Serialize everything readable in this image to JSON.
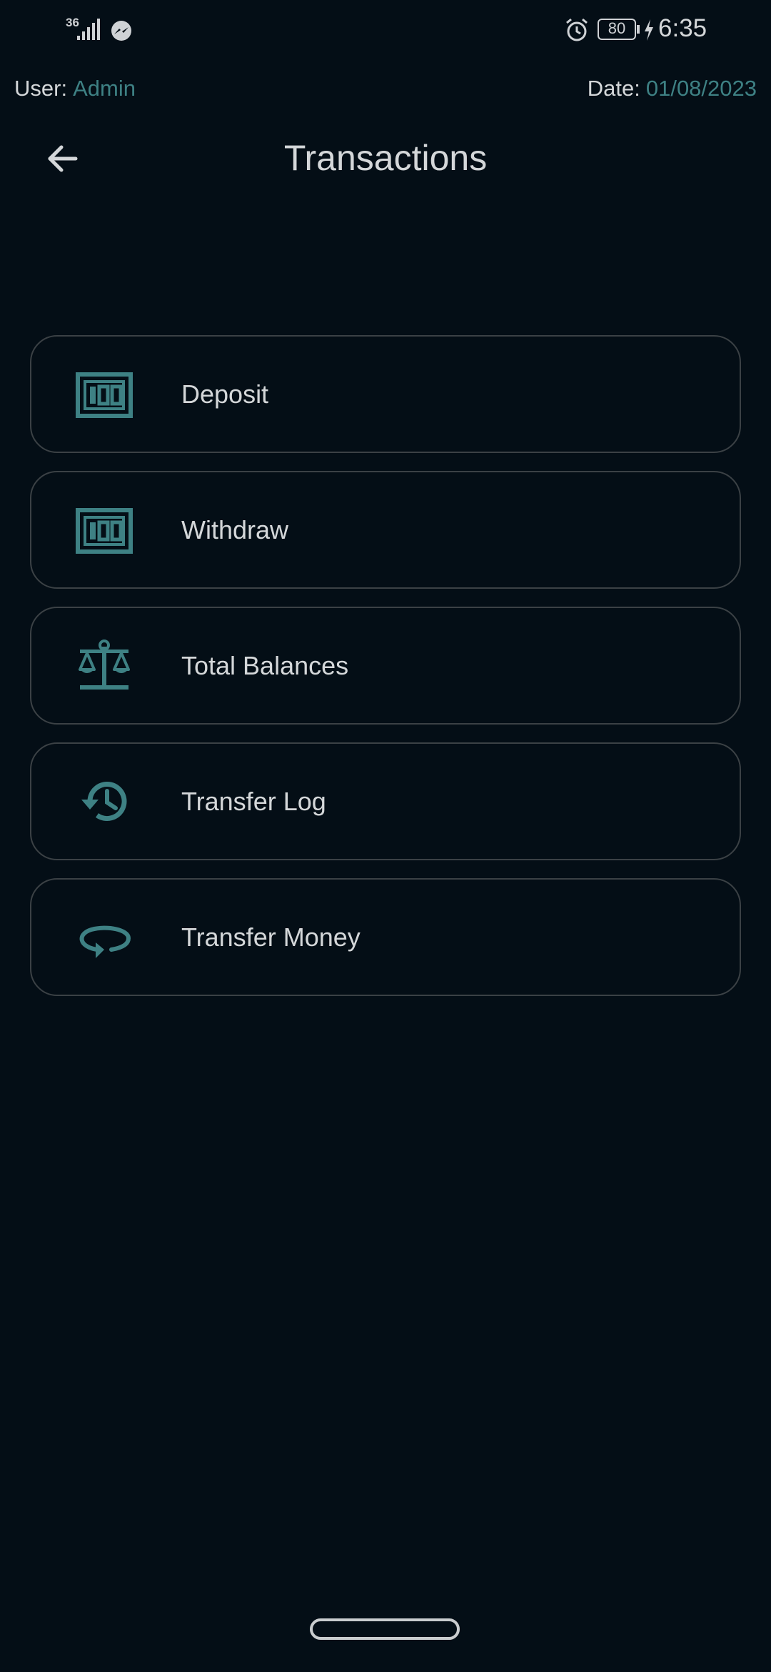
{
  "status_bar": {
    "network_type": "36",
    "battery": "80",
    "time": "6:35",
    "icons": [
      "signal-icon",
      "messenger-icon",
      "alarm-icon",
      "battery-icon",
      "charging-icon"
    ]
  },
  "header": {
    "user_label": "User:",
    "user_value": "Admin",
    "date_label": "Date:",
    "date_value": "01/08/2023",
    "title": "Transactions",
    "back_icon": "arrow-left-icon"
  },
  "menu": {
    "items": [
      {
        "label": "Deposit",
        "icon": "money-bill-icon"
      },
      {
        "label": "Withdraw",
        "icon": "money-bill-icon"
      },
      {
        "label": "Total Balances",
        "icon": "scale-balance-icon"
      },
      {
        "label": "Transfer Log",
        "icon": "history-icon"
      },
      {
        "label": "Transfer Money",
        "icon": "rotate-arrow-icon"
      }
    ]
  },
  "colors": {
    "background": "#040e16",
    "accent": "#3e8184",
    "text": "#d4d7d9",
    "card_border": "#3b4145"
  }
}
